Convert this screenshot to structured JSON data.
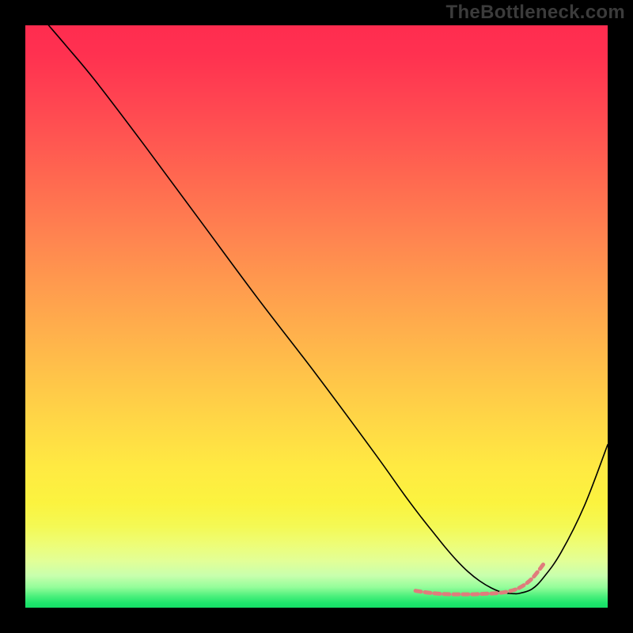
{
  "watermark": {
    "text": "TheBottleneck.com"
  },
  "chart_data": {
    "type": "line",
    "title": "",
    "xlabel": "",
    "ylabel": "",
    "xlim": [
      0,
      100
    ],
    "ylim": [
      0,
      100
    ],
    "series": [
      {
        "name": "curve",
        "stroke": "#000000",
        "stroke_width": 1.6,
        "x": [
          4,
          7,
          12,
          20,
          30,
          40,
          50,
          60,
          65,
          68,
          70,
          72,
          74,
          76,
          78,
          80,
          82,
          84,
          85,
          87,
          89,
          92,
          96,
          100
        ],
        "y": [
          100,
          96.5,
          90.5,
          80,
          66.5,
          53,
          40,
          26.5,
          19.5,
          15.5,
          13,
          10.5,
          8.2,
          6.2,
          4.6,
          3.4,
          2.6,
          2.4,
          2.5,
          3.2,
          5.2,
          9.5,
          17.5,
          28
        ]
      },
      {
        "name": "valley-dashes",
        "type": "dashed",
        "stroke": "#e07c7c",
        "stroke_width": 5,
        "dash": "7 5",
        "x": [
          67,
          69,
          71,
          73,
          75,
          77,
          79,
          81,
          83,
          85,
          87,
          89
        ],
        "y": [
          2.9,
          2.6,
          2.4,
          2.3,
          2.3,
          2.3,
          2.4,
          2.5,
          2.8,
          3.5,
          5.0,
          7.5
        ]
      }
    ],
    "background": {
      "type": "vertical_gradient",
      "stops": [
        {
          "offset": 0.0,
          "color": "#ff2c4f"
        },
        {
          "offset": 0.05,
          "color": "#ff3150"
        },
        {
          "offset": 0.12,
          "color": "#ff4251"
        },
        {
          "offset": 0.2,
          "color": "#ff5751"
        },
        {
          "offset": 0.28,
          "color": "#ff6d50"
        },
        {
          "offset": 0.36,
          "color": "#ff8350"
        },
        {
          "offset": 0.44,
          "color": "#ff994e"
        },
        {
          "offset": 0.52,
          "color": "#ffae4c"
        },
        {
          "offset": 0.6,
          "color": "#ffc349"
        },
        {
          "offset": 0.68,
          "color": "#ffd746"
        },
        {
          "offset": 0.76,
          "color": "#ffea42"
        },
        {
          "offset": 0.82,
          "color": "#fbf33f"
        },
        {
          "offset": 0.86,
          "color": "#f4f954"
        },
        {
          "offset": 0.89,
          "color": "#eefd75"
        },
        {
          "offset": 0.92,
          "color": "#e2ff97"
        },
        {
          "offset": 0.945,
          "color": "#c8ffad"
        },
        {
          "offset": 0.965,
          "color": "#94fd9a"
        },
        {
          "offset": 0.98,
          "color": "#4cf07c"
        },
        {
          "offset": 0.992,
          "color": "#1fe56c"
        },
        {
          "offset": 1.0,
          "color": "#16df67"
        }
      ]
    }
  }
}
